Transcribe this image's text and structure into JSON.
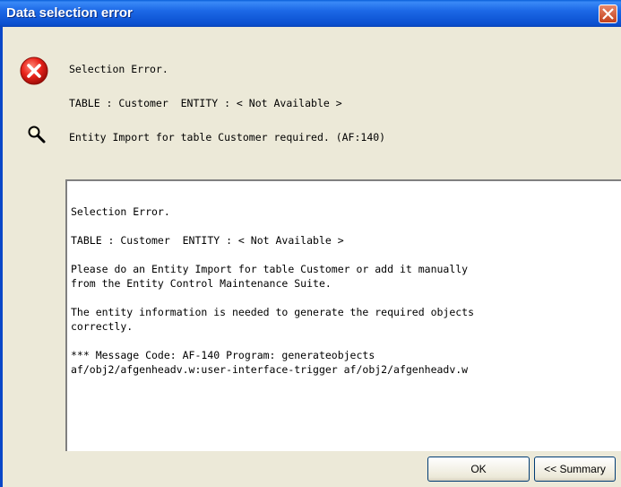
{
  "window": {
    "title": "Data selection error"
  },
  "error_icon": "error-icon",
  "search_icon": "magnifier-icon",
  "messages": {
    "line1": "Selection Error.",
    "line2": "TABLE : Customer  ENTITY : < Not Available >",
    "line3": "Entity Import for table Customer required. (AF:140)"
  },
  "details": {
    "text": "Selection Error.\n\nTABLE : Customer  ENTITY : < Not Available >\n\nPlease do an Entity Import for table Customer or add it manually\nfrom the Entity Control Maintenance Suite.\n\nThe entity information is needed to generate the required objects\ncorrectly.\n\n*** Message Code: AF-140 Program: generateobjects\naf/obj2/afgenheadv.w:user-interface-trigger af/obj2/afgenheadv.w"
  },
  "buttons": {
    "ok": "OK",
    "summary": "<< Summary"
  },
  "colors": {
    "titlebar": "#0a5fd8",
    "dialog_bg": "#ece9d8",
    "error_red": "#e8231a"
  }
}
